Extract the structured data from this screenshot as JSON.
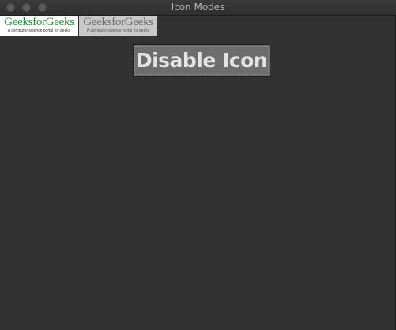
{
  "window": {
    "title": "Icon Modes"
  },
  "logos": [
    {
      "brand": "GeeksforGeeks",
      "tagline": "A computer science portal for geeks",
      "mode": "normal",
      "text_color": "#2e8b3c"
    },
    {
      "brand": "GeeksforGeeks",
      "tagline": "A computer science portal for geeks",
      "mode": "disabled",
      "text_color": "#6f6f6f"
    }
  ],
  "button": {
    "label": "Disable Icon"
  },
  "colors": {
    "window_background": "#323232",
    "button_background": "#6d6d6d",
    "button_text": "#e4e4e4"
  }
}
